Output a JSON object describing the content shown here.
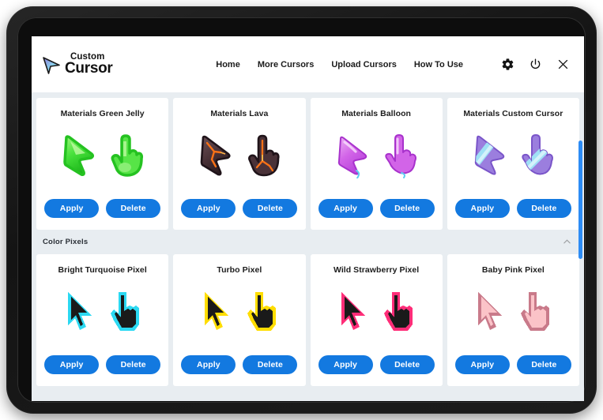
{
  "app": {
    "logo_top": "Custom",
    "logo_bottom": "Cursor",
    "logo_icon": "cursor-arrow-gradient-icon"
  },
  "header": {
    "nav": [
      {
        "label": "Home",
        "name": "nav-home"
      },
      {
        "label": "More Cursors",
        "name": "nav-more-cursors"
      },
      {
        "label": "Upload Cursors",
        "name": "nav-upload-cursors"
      },
      {
        "label": "How To Use",
        "name": "nav-how-to-use"
      }
    ],
    "icons": [
      {
        "name": "gear-icon",
        "label": "Settings"
      },
      {
        "name": "power-icon",
        "label": "Power"
      },
      {
        "name": "close-icon",
        "label": "Close"
      }
    ]
  },
  "buttons": {
    "apply": "Apply",
    "delete": "Delete"
  },
  "sections": [
    {
      "id": "materials",
      "title": null,
      "cards": [
        {
          "title": "Materials Green Jelly",
          "style": "green-jelly"
        },
        {
          "title": "Materials Lava",
          "style": "lava"
        },
        {
          "title": "Materials Balloon",
          "style": "balloon"
        },
        {
          "title": "Materials Custom Cursor",
          "style": "custom-cursor"
        }
      ]
    },
    {
      "id": "color-pixels",
      "title": "Color Pixels",
      "collapse_icon": "chevron-up-icon",
      "cards": [
        {
          "title": "Bright Turquoise Pixel",
          "style": "pixel-turquoise",
          "outline": "#2BD9F2",
          "fill": "#1a1a1a"
        },
        {
          "title": "Turbo Pixel",
          "style": "pixel-turbo",
          "outline": "#FFDD00",
          "fill": "#1a1a1a"
        },
        {
          "title": "Wild Strawberry Pixel",
          "style": "pixel-strawberry",
          "outline": "#FF2D78",
          "fill": "#1a1a1a"
        },
        {
          "title": "Baby Pink Pixel",
          "style": "pixel-babypink",
          "outline": "#C97A8A",
          "fill": "#FBC3C8"
        }
      ]
    }
  ],
  "colors": {
    "button_blue": "#1379e0",
    "scrollbar_blue": "#2d8cf5",
    "page_bg": "#e8edf1",
    "card_bg": "#ffffff",
    "header_bg": "#ffffff"
  },
  "scrollbar": {
    "name": "vertical-scrollbar",
    "position_percent": 40
  }
}
